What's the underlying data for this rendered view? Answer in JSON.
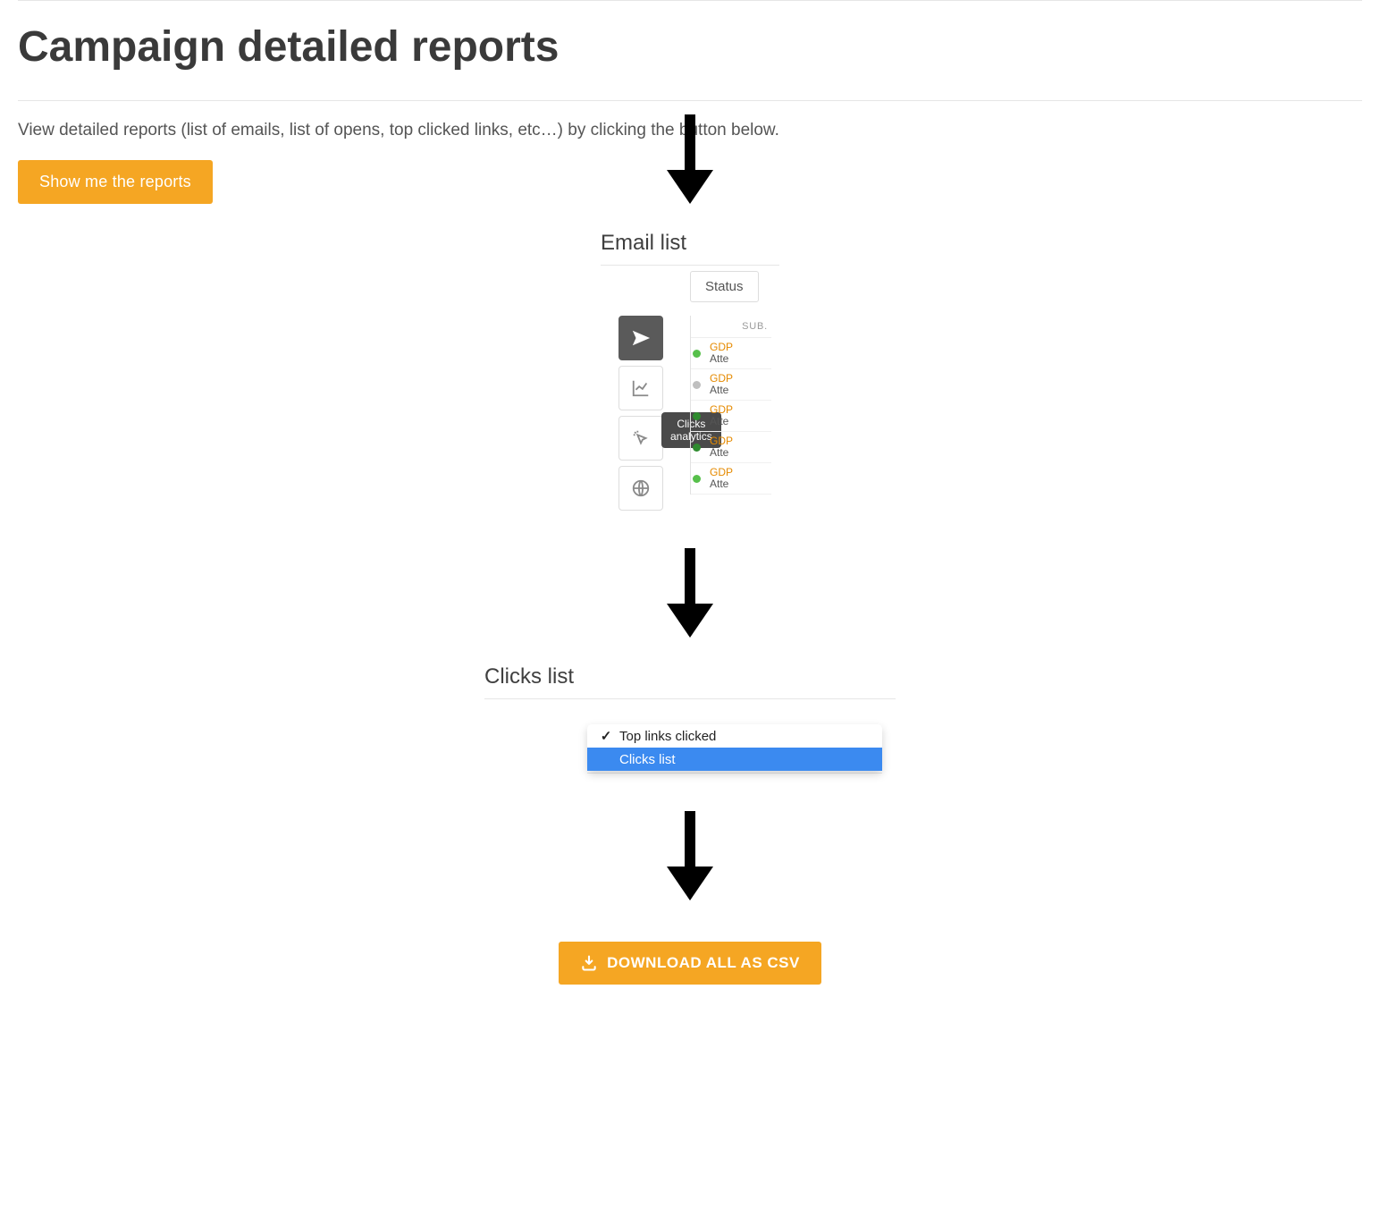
{
  "page": {
    "title": "Campaign detailed reports",
    "intro": "View detailed reports (list of emails, list of opens, top clicked links, etc…) by clicking the button below.",
    "show_reports_label": "Show me the reports"
  },
  "email_list": {
    "heading": "Email list",
    "status_label": "Status",
    "header": "SUB.",
    "tooltip_line1": "Clicks",
    "tooltip_line2": "analytics",
    "nav": {
      "send": "send",
      "chart": "chart",
      "clicks": "clicks",
      "globe": "globe"
    },
    "rows": [
      {
        "dot": "green",
        "line1": "GDP",
        "line2": "Atte"
      },
      {
        "dot": "gray",
        "line1": "GDP",
        "line2": "Atte"
      },
      {
        "dot": "darkgreen",
        "line1": "GDP",
        "line2": "Atte"
      },
      {
        "dot": "darkgreen",
        "line1": "GDP",
        "line2": "Atte"
      },
      {
        "dot": "green",
        "line1": "GDP",
        "line2": "Atte"
      }
    ]
  },
  "clicks_list": {
    "heading": "Clicks list",
    "options": {
      "top_links": "Top links clicked",
      "clicks_list": "Clicks list"
    }
  },
  "download": {
    "label": "DOWNLOAD ALL AS CSV"
  }
}
